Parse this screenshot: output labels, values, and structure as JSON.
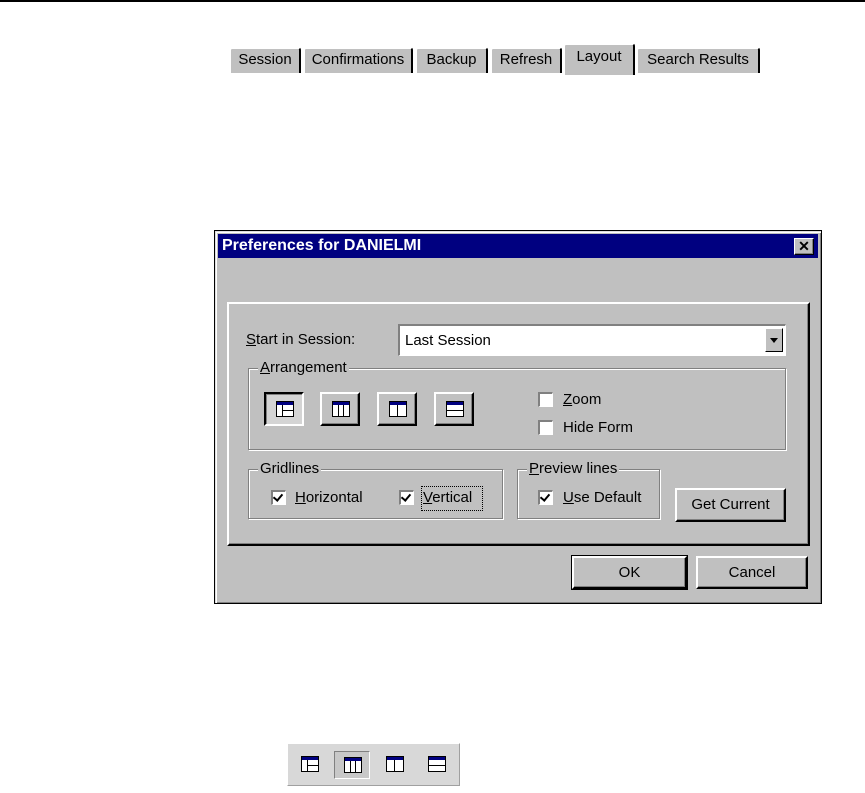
{
  "dialog": {
    "title": "Preferences for DANIELMI",
    "close_label": "✕"
  },
  "tabs": [
    {
      "label": "Session",
      "active": false
    },
    {
      "label": "Confirmations",
      "active": false
    },
    {
      "label": "Backup",
      "active": false
    },
    {
      "label": "Refresh",
      "active": false
    },
    {
      "label": "Layout",
      "active": true
    },
    {
      "label": "Search Results",
      "active": false
    }
  ],
  "layout_tab": {
    "start_in_session_label": "Start in Session:",
    "start_in_session_value": "Last Session",
    "arrangement": {
      "title": "Arrangement",
      "buttons": [
        {
          "icon": "layout-tree-split-icon",
          "pressed": true
        },
        {
          "icon": "layout-three-column-icon",
          "pressed": false
        },
        {
          "icon": "layout-two-column-icon",
          "pressed": false
        },
        {
          "icon": "layout-two-row-icon",
          "pressed": false
        }
      ],
      "zoom_label": "Zoom",
      "zoom_checked": false,
      "hide_form_label": "Hide Form",
      "hide_form_checked": false
    },
    "gridlines": {
      "title": "Gridlines",
      "horizontal_label": "Horizontal",
      "horizontal_checked": true,
      "vertical_label": "Vertical",
      "vertical_checked": true
    },
    "preview_lines": {
      "title": "Preview lines",
      "use_default_label": "Use Default",
      "use_default_checked": true
    },
    "get_current_label": "Get Current"
  },
  "footer": {
    "ok_label": "OK",
    "cancel_label": "Cancel"
  },
  "toolbar": {
    "buttons": [
      {
        "icon": "layout-tree-split-icon",
        "pressed": false
      },
      {
        "icon": "layout-three-column-icon",
        "pressed": true
      },
      {
        "icon": "layout-two-column-icon",
        "pressed": false
      },
      {
        "icon": "layout-two-row-icon",
        "pressed": false
      }
    ]
  }
}
